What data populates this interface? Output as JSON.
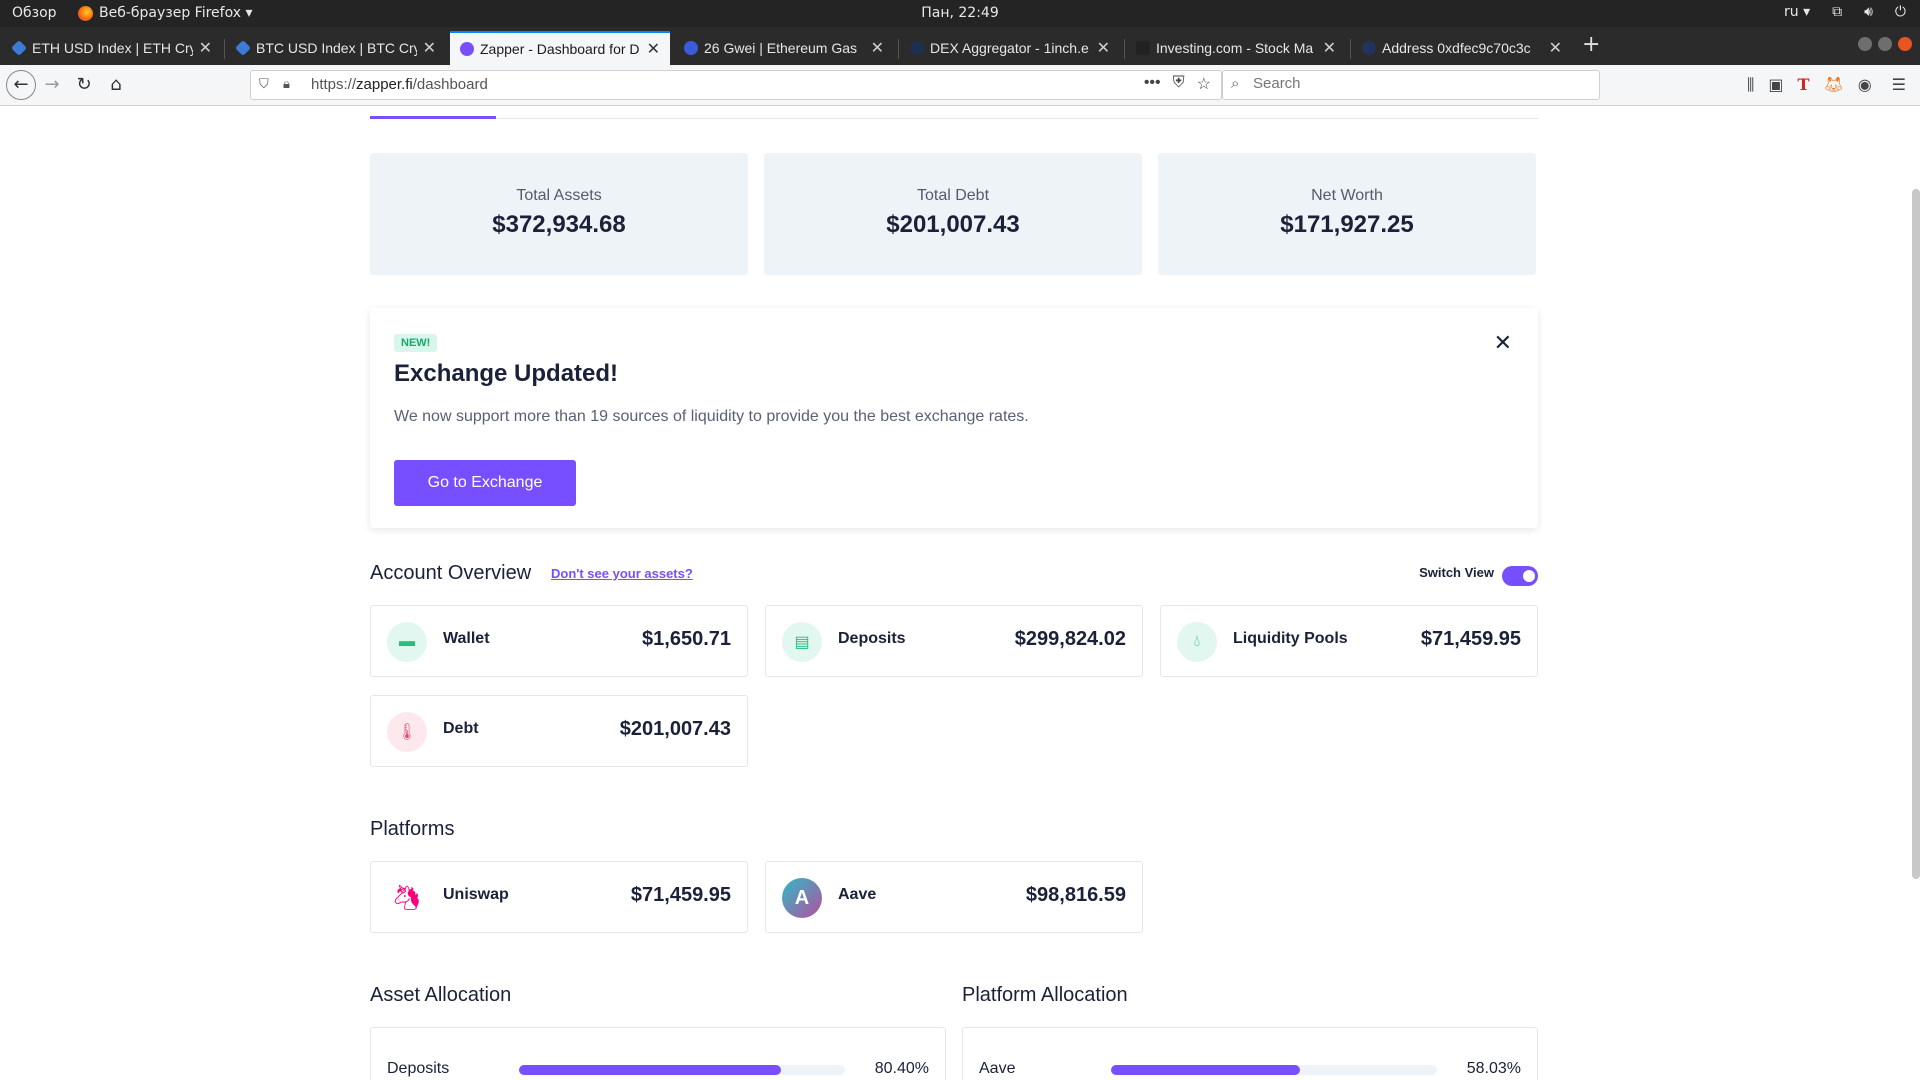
{
  "os": {
    "activities": "Обзор",
    "app_menu": "Веб-браузер Firefox ▾",
    "clock": "Пан, 22:49",
    "lang": "ru ▾"
  },
  "tabs": [
    {
      "title": "ETH USD Index | ETH Cry",
      "favicon_color": "#3d7bd9"
    },
    {
      "title": "BTC USD Index | BTC Cry",
      "favicon_color": "#3d7bd9"
    },
    {
      "title": "Zapper - Dashboard for D",
      "favicon_color": "#784ffe"
    },
    {
      "title": "26 Gwei | Ethereum Gas",
      "favicon_color": "#3b5bdb"
    },
    {
      "title": "DEX Aggregator - 1inch.e",
      "favicon_color": "#1b314f"
    },
    {
      "title": "Investing.com - Stock Ma",
      "favicon_color": "#222222"
    },
    {
      "title": "Address 0xdfec9c70c3c",
      "favicon_color": "#21325b"
    }
  ],
  "navbar": {
    "url_scheme": "https://",
    "url_host": "zapper.fi",
    "url_path": "/dashboard",
    "search_placeholder": "Search"
  },
  "summary": [
    {
      "label": "Total Assets",
      "value": "$372,934.68"
    },
    {
      "label": "Total Debt",
      "value": "$201,007.43"
    },
    {
      "label": "Net Worth",
      "value": "$171,927.25"
    }
  ],
  "banner": {
    "badge": "NEW!",
    "title": "Exchange Updated!",
    "description": "We now support more than 19 sources of liquidity to provide you the best exchange rates.",
    "cta": "Go to Exchange"
  },
  "account_overview": {
    "title": "Account Overview",
    "link": "Don't see your assets?",
    "switch_label": "Switch View",
    "items": [
      {
        "name": "Wallet",
        "amount": "$1,650.71",
        "icon": "wallet-icon"
      },
      {
        "name": "Deposits",
        "amount": "$299,824.02",
        "icon": "deposits-icon"
      },
      {
        "name": "Liquidity Pools",
        "amount": "$71,459.95",
        "icon": "droplet-icon"
      },
      {
        "name": "Debt",
        "amount": "$201,007.43",
        "icon": "thermometer-icon"
      }
    ]
  },
  "platforms": {
    "title": "Platforms",
    "items": [
      {
        "name": "Uniswap",
        "amount": "$71,459.95",
        "icon": "uniswap-icon"
      },
      {
        "name": "Aave",
        "amount": "$98,816.59",
        "icon": "aave-icon"
      }
    ]
  },
  "asset_allocation": {
    "title": "Asset Allocation",
    "rows": [
      {
        "label": "Deposits",
        "percent": "80.40%",
        "fraction": 0.804
      }
    ]
  },
  "platform_allocation": {
    "title": "Platform Allocation",
    "rows": [
      {
        "label": "Aave",
        "percent": "58.03%",
        "fraction": 0.5803
      }
    ]
  },
  "colors": {
    "accent": "#784ffe",
    "card_bg": "#eef3f7",
    "success": "#21c17e",
    "danger": "#e0477a"
  }
}
